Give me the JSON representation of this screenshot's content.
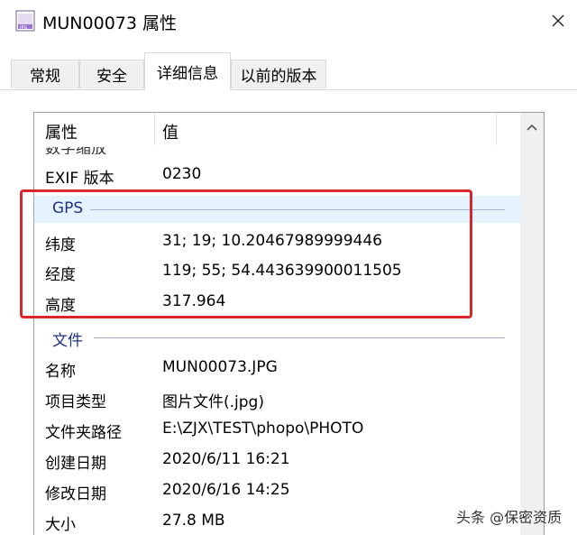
{
  "window": {
    "title": "MUN00073 属性",
    "close_symbol": "✕"
  },
  "tabs": [
    {
      "label": "常规"
    },
    {
      "label": "安全"
    },
    {
      "label": "详细信息"
    },
    {
      "label": "以前的版本"
    }
  ],
  "active_tab": "详细信息",
  "columns": {
    "name": "属性",
    "value": "值"
  },
  "clipped_row": {
    "name": "数字缩放",
    "value": "-"
  },
  "rows_top": [
    {
      "name": "EXIF 版本",
      "value": "0230"
    }
  ],
  "gps_group": {
    "label": "GPS",
    "rows": [
      {
        "name": "纬度",
        "value": "31; 19; 10.20467989999446"
      },
      {
        "name": "经度",
        "value": "119; 55; 54.443639900011505"
      },
      {
        "name": "高度",
        "value": "317.964"
      }
    ]
  },
  "file_group": {
    "label": "文件",
    "rows": [
      {
        "name": "名称",
        "value": "MUN00073.JPG"
      },
      {
        "name": "项目类型",
        "value": "图片文件(.jpg)"
      },
      {
        "name": "文件夹路径",
        "value": "E:\\ZJX\\TEST\\phopo\\PHOTO"
      },
      {
        "name": "创建日期",
        "value": "2020/6/11 16:21"
      },
      {
        "name": "修改日期",
        "value": "2020/6/16 14:25"
      },
      {
        "name": "大小",
        "value": "27.8 MB"
      }
    ]
  },
  "watermark": "头条 @保密资质",
  "colors": {
    "highlight_box": "#d9282b",
    "group_highlight": "#e5f3ff",
    "group_label": "#1e3287"
  }
}
